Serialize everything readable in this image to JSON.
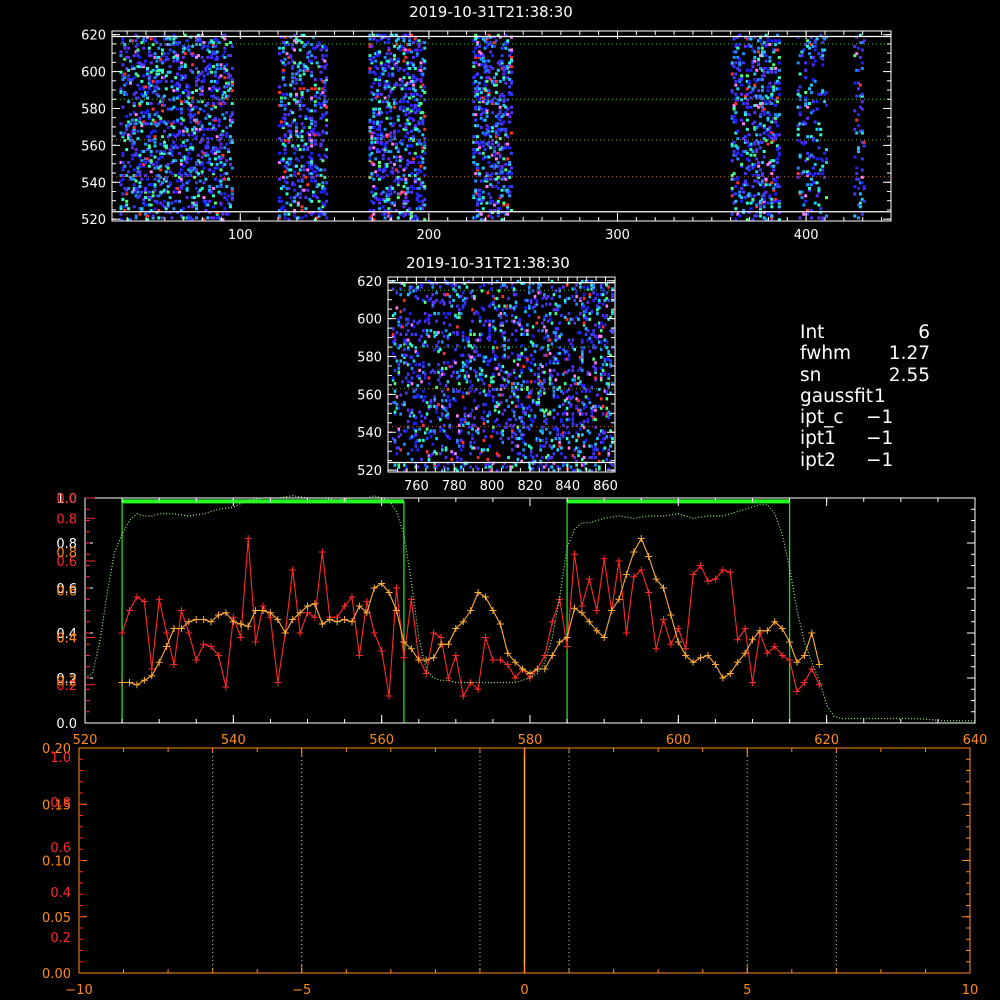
{
  "colors": {
    "background": "#000000",
    "axis_white": "#ffffff",
    "axis_orange": "#ff8c1a",
    "axis_red": "#ff2a2a",
    "series_red": "#ff2a2a",
    "series_orange": "#ffae3a",
    "series_green": "#9df08a",
    "box_green": "#22dd22",
    "box_top_green": "#22ff22",
    "refline_white": "#ffffff",
    "refline_orange": "#ffb030",
    "dotted_green": "#3fbf3f",
    "image_palette": [
      "#2020ff",
      "#3a3aff",
      "#5a30ff",
      "#1e90ff",
      "#20c8ff",
      "#30ffd0",
      "#50ff80",
      "#ff3030",
      "#ff80ff"
    ]
  },
  "info_panel": {
    "rows": [
      {
        "key": "Int",
        "value": "6"
      },
      {
        "key": "fwhm",
        "value": "1.27"
      },
      {
        "key": "sn",
        "value": "2.55"
      },
      {
        "key": "gaussfit",
        "value": "1"
      },
      {
        "key": "ipt_c",
        "value": "−1"
      },
      {
        "key": "ipt1",
        "value": "−1"
      },
      {
        "key": "ipt2",
        "value": "−1"
      }
    ]
  },
  "chart_data": [
    {
      "type": "heatmap",
      "id": "top",
      "title": "2019-10-31T21:38:30",
      "xlim": [
        32,
        445
      ],
      "ylim": [
        519,
        622
      ],
      "x_ticks": [
        "100",
        "200",
        "300",
        "400"
      ],
      "x_tick_values": [
        100,
        200,
        300,
        400
      ],
      "y_ticks": [
        "520",
        "540",
        "560",
        "580",
        "600",
        "620"
      ],
      "y_tick_values": [
        520,
        540,
        560,
        580,
        600,
        620
      ],
      "x_minor_step": 10,
      "y_minor_step": 5,
      "white_lines_y": [
        524,
        619
      ],
      "green_dotted_y": [
        585,
        615
      ],
      "orange_dotted_y": [
        543
      ],
      "olive_dotted_y": [
        563
      ],
      "pixel_clusters": [
        {
          "x": [
            36,
            95
          ],
          "density": 0.17
        },
        {
          "x": [
            120,
            145
          ],
          "density": 0.16
        },
        {
          "x": [
            168,
            197
          ],
          "density": 0.18
        },
        {
          "x": [
            223,
            243
          ],
          "density": 0.2
        },
        {
          "x": [
            360,
            385
          ],
          "density": 0.17
        },
        {
          "x": [
            395,
            410
          ],
          "density": 0.11
        },
        {
          "x": [
            425,
            430
          ],
          "density": 0.1
        }
      ]
    },
    {
      "type": "heatmap",
      "id": "zoom",
      "title": "2019-10-31T21:38:30",
      "xlim": [
        745,
        865
      ],
      "ylim": [
        519,
        622
      ],
      "x_ticks": [
        "760",
        "780",
        "800",
        "820",
        "840",
        "860"
      ],
      "x_tick_values": [
        760,
        780,
        800,
        820,
        840,
        860
      ],
      "y_ticks": [
        "520",
        "540",
        "560",
        "580",
        "600",
        "620"
      ],
      "y_tick_values": [
        520,
        540,
        560,
        580,
        600,
        620
      ],
      "x_minor_step": 5,
      "y_minor_step": 5,
      "white_lines_y": [
        524,
        619
      ],
      "green_dotted_y": [
        585,
        615
      ],
      "orange_dotted_y": [
        543
      ],
      "olive_dotted_y": [
        563
      ],
      "pixel_clusters": [
        {
          "x": [
            747,
            863
          ],
          "density": 0.14
        }
      ]
    },
    {
      "type": "line",
      "id": "profile",
      "xlim": [
        520,
        640
      ],
      "ylim": [
        0,
        1
      ],
      "x_ticks": [
        "520",
        "540",
        "560",
        "580",
        "600",
        "620",
        "640"
      ],
      "x_tick_values": [
        520,
        540,
        560,
        580,
        600,
        620,
        640
      ],
      "y_ticks": [
        "0.0",
        "0.2",
        "0.4",
        "0.6",
        "0.8",
        "1.0"
      ],
      "y_tick_values": [
        0,
        0.2,
        0.4,
        0.6,
        0.8,
        1.0
      ],
      "y_ticks_red": [
        "0.2",
        "0.4",
        "0.6",
        "0.8",
        "0.0"
      ],
      "y_ticks_red_values": [
        0.17,
        0.38,
        0.72,
        0.91,
        1.0
      ],
      "y_ticks_orange": [
        "0.2",
        "0.4",
        "0.6",
        "0.8"
      ],
      "y_ticks_orange_values": [
        0.19,
        0.38,
        0.59,
        0.76
      ],
      "boxes": [
        {
          "x0": 525,
          "x1": 563
        },
        {
          "x0": 585,
          "x1": 615
        }
      ],
      "box_top_y": 0.985,
      "series": [
        {
          "color_key": "series_red",
          "markers": true,
          "x": [
            525,
            526,
            527,
            528,
            529,
            530,
            531,
            532,
            533,
            534,
            535,
            536,
            537,
            538,
            539,
            540,
            541,
            542,
            543,
            544,
            545,
            546,
            547,
            548,
            549,
            550,
            551,
            552,
            553,
            554,
            555,
            556,
            557,
            558,
            559,
            560,
            561,
            562,
            563,
            564,
            565,
            566,
            567,
            568,
            569,
            570,
            571,
            572,
            573,
            574,
            575,
            576,
            577,
            578,
            579,
            580,
            581,
            582,
            583,
            584,
            585,
            586,
            587,
            588,
            589,
            590,
            591,
            592,
            593,
            594,
            595,
            596,
            597,
            598,
            599,
            600,
            601,
            602,
            603,
            604,
            605,
            606,
            607,
            608,
            609,
            610,
            611,
            612,
            613,
            614,
            615,
            616,
            617,
            618,
            619
          ],
          "y": [
            0.4,
            0.5,
            0.56,
            0.54,
            0.24,
            0.55,
            0.4,
            0.26,
            0.5,
            0.4,
            0.28,
            0.35,
            0.34,
            0.3,
            0.16,
            0.47,
            0.38,
            0.82,
            0.36,
            0.52,
            0.47,
            0.18,
            0.4,
            0.68,
            0.4,
            0.49,
            0.47,
            0.76,
            0.47,
            0.47,
            0.52,
            0.56,
            0.3,
            0.54,
            0.4,
            0.32,
            0.12,
            0.6,
            0.29,
            0.55,
            0.29,
            0.22,
            0.4,
            0.38,
            0.2,
            0.3,
            0.12,
            0.18,
            0.15,
            0.38,
            0.28,
            0.28,
            0.26,
            0.2,
            0.24,
            0.2,
            0.24,
            0.3,
            0.45,
            0.55,
            0.34,
            0.75,
            0.52,
            0.64,
            0.5,
            0.73,
            0.5,
            0.72,
            0.4,
            0.65,
            0.68,
            0.58,
            0.33,
            0.46,
            0.35,
            0.42,
            0.33,
            0.66,
            0.7,
            0.63,
            0.64,
            0.68,
            0.67,
            0.37,
            0.42,
            0.18,
            0.4,
            0.31,
            0.34,
            0.3,
            0.28,
            0.14,
            0.18,
            0.24,
            0.17
          ]
        },
        {
          "color_key": "series_orange",
          "markers": true,
          "x": [
            525,
            526,
            527,
            528,
            529,
            530,
            531,
            532,
            533,
            534,
            535,
            536,
            537,
            538,
            539,
            540,
            541,
            542,
            543,
            544,
            545,
            546,
            547,
            548,
            549,
            550,
            551,
            552,
            553,
            554,
            555,
            556,
            557,
            558,
            559,
            560,
            561,
            562,
            563,
            564,
            565,
            566,
            567,
            568,
            569,
            570,
            571,
            572,
            573,
            574,
            575,
            576,
            577,
            578,
            579,
            580,
            581,
            582,
            583,
            584,
            585,
            586,
            587,
            588,
            589,
            590,
            591,
            592,
            593,
            594,
            595,
            596,
            597,
            598,
            599,
            600,
            601,
            602,
            603,
            604,
            605,
            606,
            607,
            608,
            609,
            610,
            611,
            612,
            613,
            614,
            615,
            616,
            617,
            618,
            619
          ],
          "y": [
            0.18,
            0.18,
            0.17,
            0.19,
            0.21,
            0.27,
            0.34,
            0.42,
            0.42,
            0.45,
            0.46,
            0.46,
            0.45,
            0.48,
            0.49,
            0.45,
            0.44,
            0.43,
            0.5,
            0.5,
            0.49,
            0.46,
            0.4,
            0.46,
            0.49,
            0.52,
            0.53,
            0.44,
            0.46,
            0.45,
            0.46,
            0.45,
            0.52,
            0.49,
            0.6,
            0.62,
            0.58,
            0.5,
            0.36,
            0.33,
            0.28,
            0.28,
            0.29,
            0.35,
            0.35,
            0.42,
            0.45,
            0.5,
            0.58,
            0.56,
            0.5,
            0.44,
            0.31,
            0.27,
            0.24,
            0.22,
            0.24,
            0.24,
            0.3,
            0.36,
            0.38,
            0.51,
            0.49,
            0.45,
            0.41,
            0.38,
            0.5,
            0.55,
            0.66,
            0.76,
            0.82,
            0.74,
            0.64,
            0.6,
            0.48,
            0.36,
            0.3,
            0.27,
            0.29,
            0.3,
            0.26,
            0.2,
            0.22,
            0.27,
            0.31,
            0.37,
            0.41,
            0.41,
            0.45,
            0.42,
            0.36,
            0.27,
            0.3,
            0.4,
            0.26
          ]
        },
        {
          "color_key": "series_green",
          "markers": false,
          "dotted": true,
          "x": [
            520,
            521,
            522,
            523,
            524,
            525,
            526,
            527,
            528,
            529,
            530,
            532,
            534,
            536,
            538,
            540,
            542,
            544,
            546,
            548,
            550,
            552,
            554,
            556,
            558,
            559,
            560,
            561,
            562,
            563,
            564,
            565,
            566,
            567,
            568,
            569,
            570,
            572,
            574,
            576,
            578,
            580,
            581,
            582,
            583,
            584,
            585,
            586,
            587,
            588,
            589,
            590,
            592,
            594,
            596,
            598,
            600,
            602,
            604,
            606,
            608,
            610,
            611,
            612,
            613,
            614,
            615,
            616,
            617,
            618,
            619,
            620,
            621,
            622,
            624,
            628,
            632,
            636,
            640
          ],
          "y": [
            0.2,
            0.22,
            0.36,
            0.58,
            0.76,
            0.84,
            0.9,
            0.93,
            0.92,
            0.92,
            0.93,
            0.93,
            0.92,
            0.93,
            0.95,
            0.96,
            0.99,
            1.0,
            1.0,
            1.01,
            1.0,
            1.0,
            0.99,
            1.0,
            1.0,
            1.01,
            1.0,
            0.99,
            0.94,
            0.84,
            0.63,
            0.38,
            0.24,
            0.2,
            0.19,
            0.19,
            0.18,
            0.18,
            0.18,
            0.18,
            0.18,
            0.2,
            0.22,
            0.27,
            0.38,
            0.56,
            0.78,
            0.86,
            0.89,
            0.89,
            0.9,
            0.91,
            0.92,
            0.91,
            0.92,
            0.92,
            0.93,
            0.91,
            0.92,
            0.92,
            0.94,
            0.96,
            0.97,
            0.97,
            0.93,
            0.84,
            0.69,
            0.5,
            0.36,
            0.27,
            0.19,
            0.08,
            0.03,
            0.02,
            0.02,
            0.02,
            0.02,
            0.01,
            0.01
          ]
        }
      ]
    },
    {
      "type": "line",
      "id": "bottom",
      "xlim": [
        -10,
        10
      ],
      "ylim": [
        0,
        1
      ],
      "x_ticks": [
        "−10",
        "−5",
        "0",
        "5",
        "10"
      ],
      "x_tick_values": [
        -10,
        -5,
        0,
        5,
        10
      ],
      "y_ticks_orange": [
        "0.00",
        "0.05",
        "0.10",
        "0.15",
        "0.20"
      ],
      "y_ticks_orange_values": [
        0,
        0.25,
        0.5,
        0.75,
        1.0
      ],
      "y_ticks_red": [
        "0.2",
        "0.4",
        "0.6",
        "0.8",
        "1.0"
      ],
      "y_ticks_red_values": [
        0.2,
        0.4,
        0.6,
        0.8,
        1.0
      ],
      "dotted_vlines_x": [
        -7,
        -5,
        -1,
        1,
        5,
        7
      ],
      "center_line_x": 0
    }
  ]
}
